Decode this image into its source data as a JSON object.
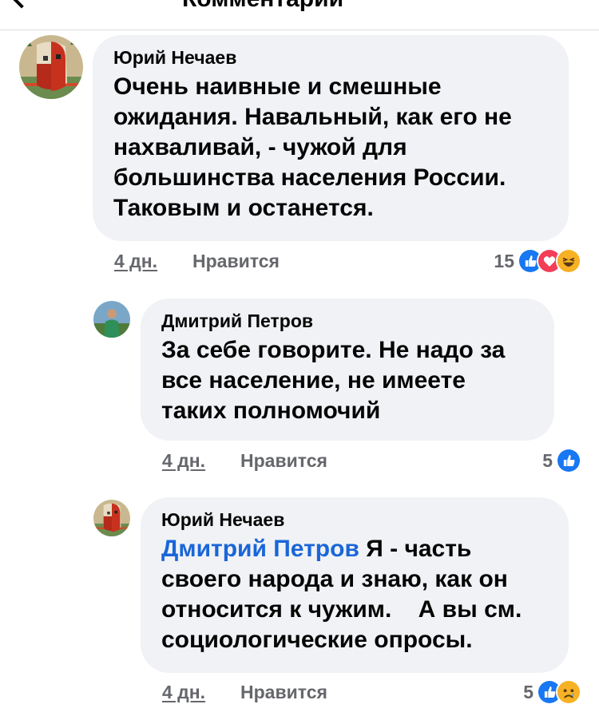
{
  "header": {
    "title": "Комментарии"
  },
  "comments": [
    {
      "author": "Юрий Нечаев",
      "mention": "",
      "text": "Очень наивные и смешные ожидания. Навальный, как его не нахваливай, - чужой для большинства населения России. Таковым и останется.",
      "time": "4 дн.",
      "like_label": "Нравится",
      "reaction_count": "15",
      "reactions": [
        "like-icon",
        "love-icon",
        "haha-icon"
      ]
    },
    {
      "author": "Дмитрий Петров",
      "mention": "",
      "text": "За себе говорите. Не надо за все население, не имеете таких полномочий",
      "time": "4 дн.",
      "like_label": "Нравится",
      "reaction_count": "5",
      "reactions": [
        "like-icon"
      ]
    },
    {
      "author": "Юрий Нечаев",
      "mention": "Дмитрий Петров",
      "text": "Я - часть своего народа и знаю, как он относится к чужим.    А вы см. социологические опросы.",
      "time": "4 дн.",
      "like_label": "Нравится",
      "reaction_count": "5",
      "reactions": [
        "like-icon",
        "sad-icon"
      ]
    }
  ],
  "colors": {
    "bubble": "#f0f2f5",
    "meta": "#65676b",
    "mention": "#1a66d8",
    "like": "#1877f2",
    "love": "#f33e58",
    "haha": "#f7b125"
  }
}
